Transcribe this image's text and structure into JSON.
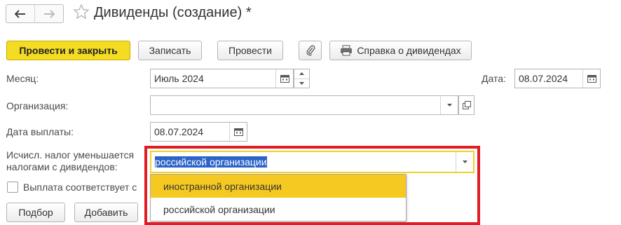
{
  "window": {
    "title": "Дивиденды (создание) *"
  },
  "toolbar": {
    "post_close_label": "Провести и закрыть",
    "save_label": "Записать",
    "post_label": "Провести",
    "report_label": "Справка о дивидендах"
  },
  "form": {
    "month": {
      "label": "Месяц:",
      "value": "Июль 2024"
    },
    "date": {
      "label": "Дата:",
      "value": "08.07.2024"
    },
    "organization": {
      "label": "Организация:",
      "value": ""
    },
    "pay_date": {
      "label": "Дата выплаты:",
      "value": "08.07.2024"
    },
    "tax_reduce": {
      "label_line1": "Исчисл. налог уменьшается",
      "label_line2": "налогами с дивидендов:",
      "value": "российской организации",
      "options": [
        "иностранной организации",
        "российской организации"
      ],
      "highlighted_option": "иностранной организации"
    },
    "payment_checkbox": {
      "label": "Выплата соответствует с",
      "checked": false
    }
  },
  "table_toolbar": {
    "select_label": "Подбор",
    "add_label": "Добавить"
  },
  "colors": {
    "accent_yellow": "#f4dc22",
    "highlight": "#f6c922",
    "annotation_red": "#e11c24",
    "selection_blue": "#2b63c8"
  }
}
